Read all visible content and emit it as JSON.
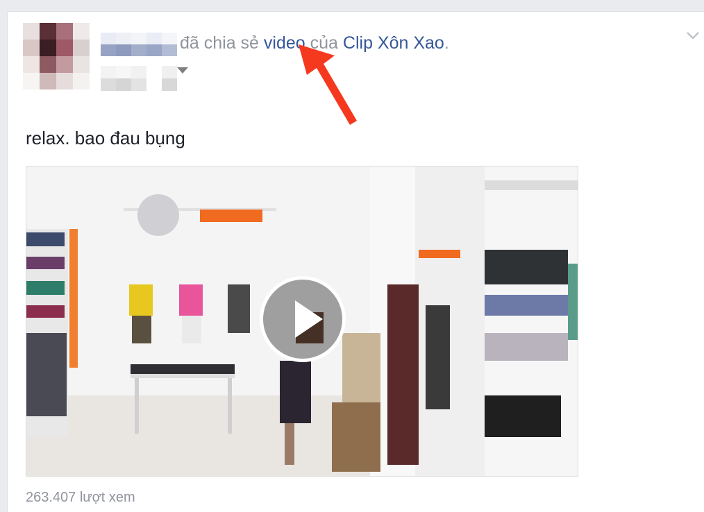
{
  "post": {
    "headline": {
      "action_text": "đã chia sẻ",
      "object_link": "video",
      "connector": "của",
      "page_link": "Clip Xôn Xao",
      "end_punct": "."
    },
    "message_line_1": "relax. bao đau bụng",
    "message_line_2": ":))",
    "video": {
      "play_icon": "play-icon"
    },
    "view_count": "263.407 lượt xem"
  },
  "colors": {
    "link": "#365899",
    "muted_text": "#90949c",
    "body_text": "#1d2129",
    "annotation_arrow": "#f5391f",
    "card_bg": "#ffffff",
    "page_bg": "#e9ebee"
  },
  "icons": {
    "options_menu": "chevron-down-icon",
    "audience_selector": "caret-down-icon"
  }
}
